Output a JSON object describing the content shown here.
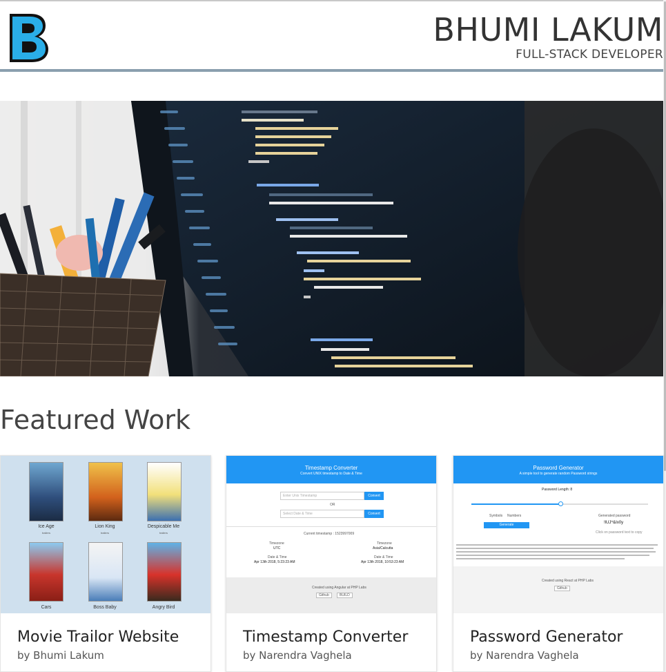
{
  "header": {
    "name": "BHUMI LAKUM",
    "title": "FULL-STACK DEVELOPER",
    "logo_letter": "B",
    "logo_color": "#29a9e6"
  },
  "hero": {
    "image": "laptop-with-code-icon"
  },
  "featured": {
    "heading": "Featured Work",
    "cards": [
      {
        "title": "Movie Trailor Website",
        "author": "by Bhumi Lakum",
        "movies": [
          {
            "name": "Ice Age",
            "sub": "trailers"
          },
          {
            "name": "Lion King",
            "sub": "trailers"
          },
          {
            "name": "Despicable Me",
            "sub": "trailers"
          },
          {
            "name": "Cars",
            "sub": ""
          },
          {
            "name": "Boss Baby",
            "sub": ""
          },
          {
            "name": "Angry Bird",
            "sub": ""
          }
        ]
      },
      {
        "title": "Timestamp Converter",
        "author": "by Narendra Vaghela",
        "app_title": "Timestamp Converter",
        "app_subtitle": "Convert UNIX timestamp to Date & Time",
        "input1_placeholder": "Enter Unix Timestamp",
        "or_label": "OR",
        "input2_placeholder": "Select Date & Time",
        "convert_label": "Convert",
        "current_label": "Current timestamp : 1523997009",
        "tz_left_label": "Timezone",
        "tz_left": "UTC",
        "tz_right_label": "Timezone",
        "tz_right": "Asia/Calcutta",
        "dt_label": "Date & Time",
        "dt_left": "Apr 13th 2018, 5:23:23 AM",
        "dt_right": "Apr 13th 2018, 10:53:23 AM",
        "footer_text": "Created using Angular at PHP Labs",
        "badge1": "Github",
        "badge2": "BUILD"
      },
      {
        "title": "Password Generator",
        "author": "by Narendra Vaghela",
        "app_title": "Password Generator",
        "app_subtitle": "A simple tool to generate random Password strings",
        "length_label": "Password Length: 8",
        "symbols_label": "Symbols",
        "numbers_label": "Numbers",
        "generate_label": "Generate",
        "generated_label": "Generated password",
        "generated_value": "!lUJ^&Ix0y",
        "copy_hint": "Click on password text to copy",
        "footer_text": "Created using React at PHP Labs",
        "badge1": "Github"
      }
    ]
  }
}
